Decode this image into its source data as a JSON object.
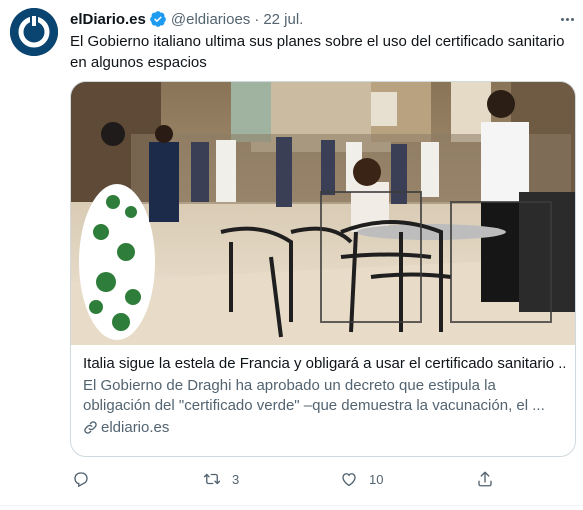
{
  "tweet": {
    "display_name": "elDiario.es",
    "handle": "@eldiarioes",
    "separator": "·",
    "date": "22 jul.",
    "text": "El Gobierno italiano ultima sus planes sobre el uso del certificado sanitario en algunos espacios",
    "avatar_icon": "eldiario-logo-icon",
    "verified_icon": "verified-badge-icon",
    "accent_color": "#1d9bf0",
    "avatar_color": "#0a4470"
  },
  "card": {
    "title": "Italia sigue la estela de Francia y obligará a usar el certificado sanitario ...",
    "description": "El Gobierno de Draghi ha aprobado un decreto que estipula la obligación del \"certificado verde\" –que demuestra la vacunación, el ...",
    "domain": "eldiario.es",
    "image_alt": "Café con terraza en una galería comercial italiana"
  },
  "actions": {
    "reply_count": "",
    "retweet_count": "3",
    "like_count": "10",
    "share_count": ""
  }
}
